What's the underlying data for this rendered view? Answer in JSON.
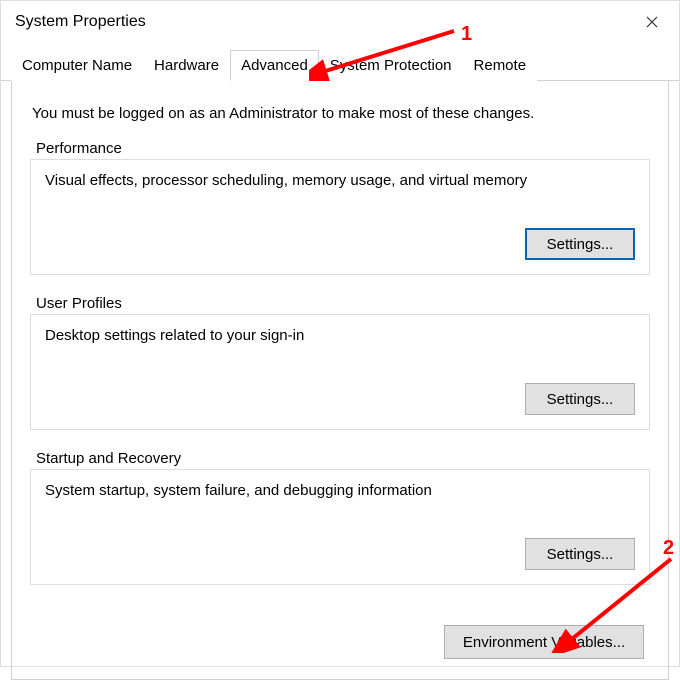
{
  "window": {
    "title": "System Properties"
  },
  "tabs": {
    "items": [
      {
        "label": "Computer Name"
      },
      {
        "label": "Hardware"
      },
      {
        "label": "Advanced"
      },
      {
        "label": "System Protection"
      },
      {
        "label": "Remote"
      }
    ],
    "activeIndex": 2
  },
  "advanced": {
    "intro": "You must be logged on as an Administrator to make most of these changes.",
    "performance": {
      "title": "Performance",
      "desc": "Visual effects, processor scheduling, memory usage, and virtual memory",
      "button": "Settings..."
    },
    "userProfiles": {
      "title": "User Profiles",
      "desc": "Desktop settings related to your sign-in",
      "button": "Settings..."
    },
    "startupRecovery": {
      "title": "Startup and Recovery",
      "desc": "System startup, system failure, and debugging information",
      "button": "Settings..."
    },
    "envVarsButton": "Environment Variables..."
  },
  "annotations": {
    "one": "1",
    "two": "2"
  }
}
